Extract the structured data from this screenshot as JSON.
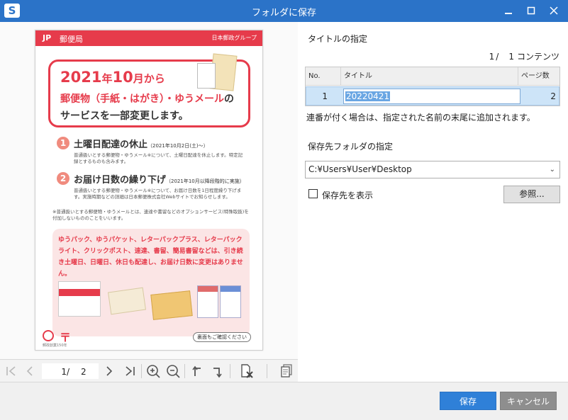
{
  "window": {
    "app_icon_letter": "S",
    "title": "フォルダに保存",
    "minimize_glyph": "—",
    "maximize_glyph": "☐",
    "close_glyph": "✕"
  },
  "preview": {
    "page": {
      "header_logo": "JP",
      "header_office": "郵便局",
      "header_group": "日本郵政グループ",
      "headline_1_year": "2021",
      "headline_1_nen": "年",
      "headline_1_month": "10",
      "headline_1_rest": "月から",
      "headline_2_red": "郵便物（手紙・はがき）・ゆうメール",
      "headline_2_rest": "の",
      "headline_3": "サービスを一部変更します。",
      "item1_num": "1",
      "item1_title": "土曜日配達の休止",
      "item1_date": "（2021年10月2日(土)〜）",
      "item1_desc": "普通扱いとする郵便物・ゆうメール※について、土曜日配達を休止します。特定記録とするものも含みます。",
      "item2_num": "2",
      "item2_title": "お届け日数の繰り下げ",
      "item2_date": "（2021年10月以降段階的に実施）",
      "item2_desc": "普通扱いとする郵便物・ゆうメール※について、お届け日数を1日程度繰り下げます。実施時期などの詳細は日本郵便株式会社Webサイトでお知らせします。",
      "note": "※普通扱いとする郵便物・ゆうメールとは、速達や書留などのオプションサービス(特殊取扱)を付加しないもののことをいいます。",
      "pink_text": "ゆうパック、ゆうパケット、レターパックプラス、レターパックライト、クリックポスト、速達、書留、簡易書留などは、引き続き土曜日、日曜日、休日も配達し、お届け日数に変更はありません。",
      "footer_post_mark": "〒",
      "footer_anniversary": "郵政創業150年",
      "back_note": "裏面もご確認ください"
    }
  },
  "toolbar": {
    "current_page": "1",
    "separator": "/",
    "total_pages": "2"
  },
  "right": {
    "title_section_label": "タイトルの指定",
    "count_current": "1",
    "count_separator": "/",
    "count_total": "1",
    "count_unit": "コンテンツ",
    "table": {
      "headers": [
        "No.",
        "タイトル",
        "ページ数"
      ],
      "rows": [
        {
          "no": "1",
          "title": "20220421",
          "pages": "2"
        }
      ]
    },
    "hint": "連番が付く場合は、指定された名前の末尾に追加されます。",
    "folder_section_label": "保存先フォルダの指定",
    "folder_path": "C:¥Users¥User¥Desktop",
    "show_destination_label": "保存先を表示",
    "show_destination_checked": false,
    "browse_label": "参照..."
  },
  "footer": {
    "save_label": "保存",
    "cancel_label": "キャンセル"
  },
  "colors": {
    "titlebar": "#2b73c8",
    "save_button": "#2f80d8",
    "cancel_button": "#8e8e8e",
    "selected_row": "#cde4f8"
  }
}
